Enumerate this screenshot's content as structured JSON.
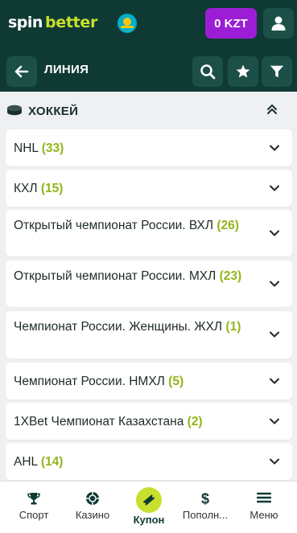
{
  "header": {
    "logo_part1": "spin",
    "logo_part2": "better",
    "balance": "0 KZT",
    "colors": {
      "bg": "#0f3a34",
      "accent": "#c8e02d",
      "balance": "#9b1ed6"
    }
  },
  "subheader": {
    "title": "ЛИНИЯ",
    "icons": [
      "back-arrow-icon",
      "search-icon",
      "star-icon",
      "filter-icon"
    ]
  },
  "sport": {
    "title": "ХОККЕЙ",
    "icon": "hockey-puck-icon"
  },
  "leagues": [
    {
      "name": "NHL",
      "count": "(33)"
    },
    {
      "name": "КХЛ",
      "count": "(15)"
    },
    {
      "name": "Открытый чемпионат России. ВХЛ",
      "count": "(26)"
    },
    {
      "name": "Открытый чемпионат России. МХЛ",
      "count": "(23)"
    },
    {
      "name": "Чемпионат России. Женщины. ЖХЛ",
      "count": "(1)"
    },
    {
      "name": "Чемпионат России. НМХЛ",
      "count": "(5)"
    },
    {
      "name": "1XBet Чемпионат Казахстана",
      "count": "(2)"
    },
    {
      "name": "AHL",
      "count": "(14)"
    }
  ],
  "bottom_nav": [
    {
      "label": "Спорт",
      "icon": "trophy-icon"
    },
    {
      "label": "Казино",
      "icon": "casino-chip-icon"
    },
    {
      "label": "Купон",
      "icon": "ticket-icon",
      "active": true
    },
    {
      "label": "Пополн...",
      "icon": "dollar-icon"
    },
    {
      "label": "Меню",
      "icon": "menu-icon"
    }
  ]
}
